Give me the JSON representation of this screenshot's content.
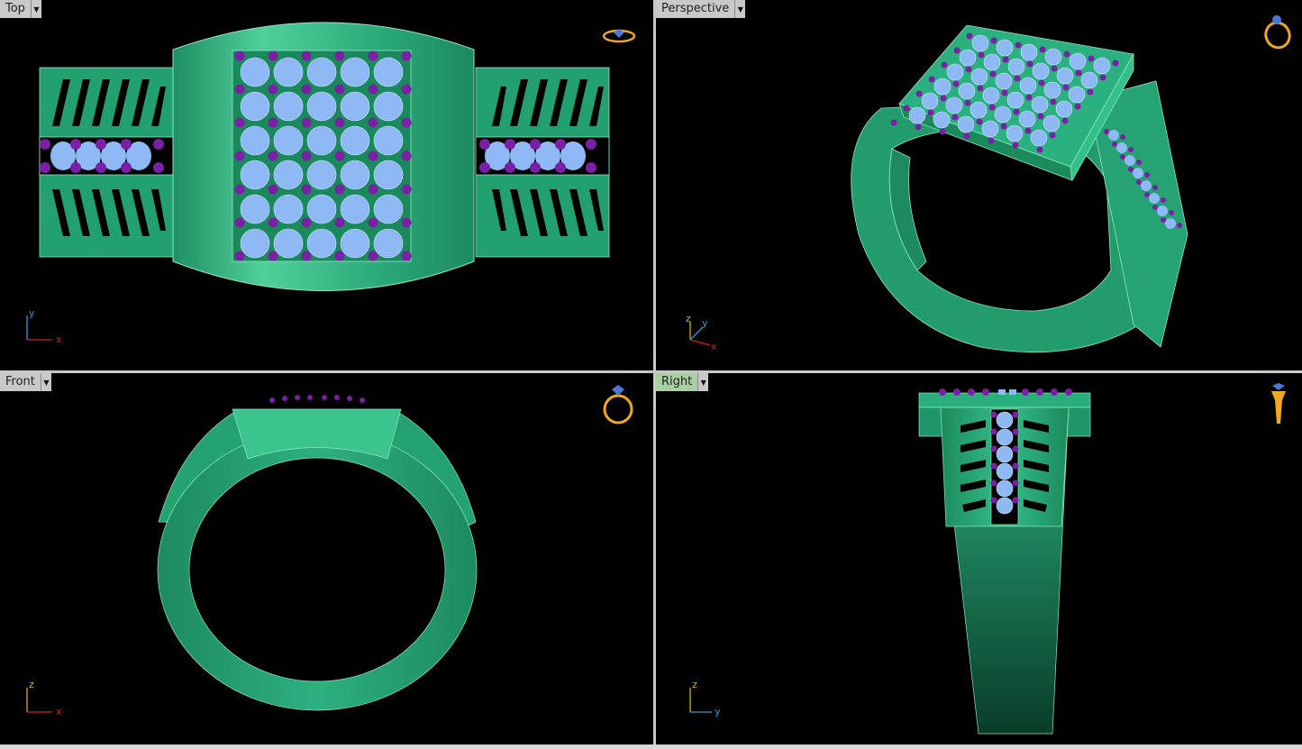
{
  "viewports": {
    "top": {
      "label": "Top",
      "axis_v": "y",
      "axis_h": "x"
    },
    "perspective": {
      "label": "Perspective",
      "axis_a": "z",
      "axis_b": "y",
      "axis_h": "x"
    },
    "front": {
      "label": "Front",
      "axis_v": "z",
      "axis_h": "x"
    },
    "right": {
      "label": "Right",
      "axis_v": "z",
      "axis_h": "y"
    }
  },
  "colors": {
    "viewport_bg": "#000000",
    "metal": "#2db07f",
    "metal_light": "#5fd9a6",
    "stone_main": "#8fb9f5",
    "stone_accent": "#7b1fa6",
    "axis_x": "#d02020",
    "axis_y": "#2f9bd8",
    "axis_z": "#d4b000",
    "icon_gold": "#f2a81d",
    "active_tab": "#a7cfa2"
  },
  "icons": [
    "ring-top-icon",
    "ring-perspective-icon",
    "ring-front-icon",
    "ring-side-icon",
    "dropdown-arrow-icon"
  ]
}
